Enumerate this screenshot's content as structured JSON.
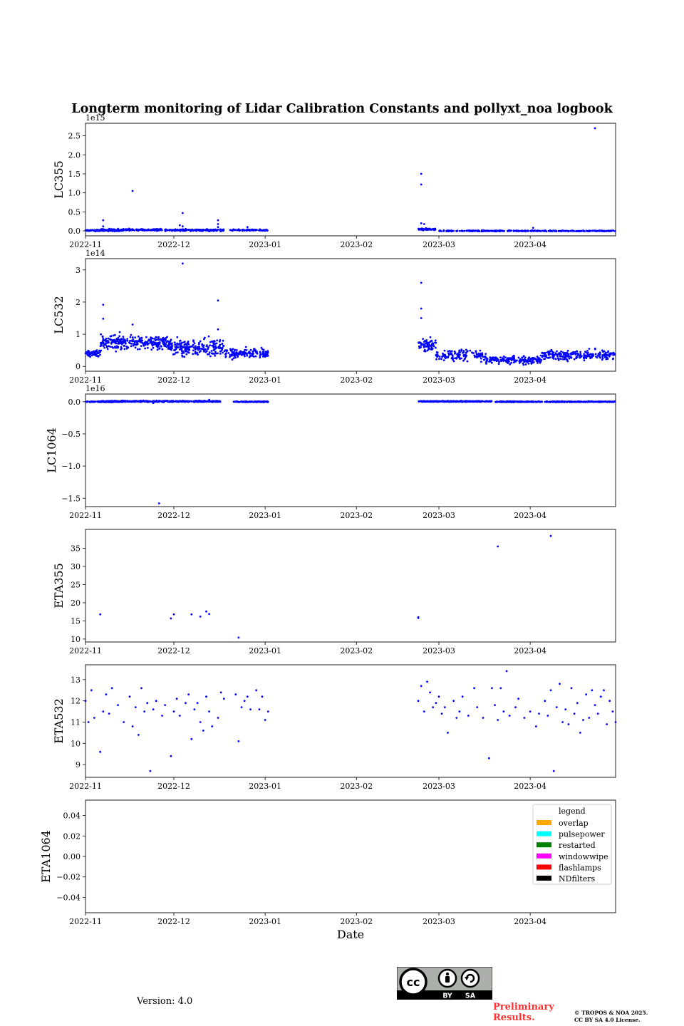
{
  "figure": {
    "title": "Longterm monitoring of Lidar Calibration Constants and pollyxt_noa logbook",
    "xlabel": "Date",
    "version_text": "Version: 4.0",
    "preliminary_line1": "Preliminary",
    "preliminary_line2": "Results.",
    "copyright_line1": "© TROPOS & NOA 2025.",
    "copyright_line2": "CC BY SA 4.0 License.",
    "license_badge": {
      "label_by": "BY",
      "label_sa": "SA",
      "icon": "cc-by-sa-icon"
    },
    "colors": {
      "points": "#0000ff",
      "text": "#000000",
      "prelim": "#ff3030"
    }
  },
  "chart_data": [
    {
      "type": "scatter",
      "ylabel": "LC355",
      "offset_text": "1e15",
      "x_ticks": [
        "2022-11",
        "2022-12",
        "2023-01",
        "2023-02",
        "2023-03",
        "2023-04"
      ],
      "x_range": [
        "2022-11-01",
        "2023-04-30"
      ],
      "y_ticks": [
        0.0,
        0.5,
        1.0,
        1.5,
        2.0,
        2.5
      ],
      "y_tick_labels": [
        "0.0",
        "0.5",
        "1.0",
        "1.5",
        "2.0",
        "2.5"
      ],
      "ylim": [
        -0.13,
        2.83
      ],
      "segments": [
        {
          "start": "2022-11-01",
          "end": "2022-11-14",
          "mean": 0.01,
          "spread": 0.015,
          "density": 8
        },
        {
          "start": "2022-11-06",
          "end": "2022-11-27",
          "mean": 0.03,
          "spread": 0.02,
          "density": 8
        },
        {
          "start": "2022-11-28",
          "end": "2022-12-18",
          "mean": 0.02,
          "spread": 0.02,
          "density": 8
        },
        {
          "start": "2022-12-20",
          "end": "2023-01-02",
          "mean": 0.02,
          "spread": 0.015,
          "density": 7
        },
        {
          "start": "2023-02-22",
          "end": "2023-02-28",
          "mean": 0.04,
          "spread": 0.02,
          "density": 9
        },
        {
          "start": "2023-03-01",
          "end": "2023-04-30",
          "mean": 0.0,
          "spread": 0.01,
          "density": 5
        }
      ],
      "outliers": [
        [
          "2022-11-07",
          0.28
        ],
        [
          "2022-11-07",
          0.12
        ],
        [
          "2022-11-17",
          1.05
        ],
        [
          "2022-12-04",
          0.47
        ],
        [
          "2022-12-03",
          0.15
        ],
        [
          "2022-12-04",
          0.12
        ],
        [
          "2022-12-16",
          0.28
        ],
        [
          "2022-12-16",
          0.18
        ],
        [
          "2022-12-16",
          0.1
        ],
        [
          "2022-12-26",
          0.1
        ],
        [
          "2023-02-23",
          1.5
        ],
        [
          "2023-02-23",
          1.22
        ],
        [
          "2023-02-23",
          0.2
        ],
        [
          "2023-02-24",
          0.18
        ],
        [
          "2023-04-02",
          0.08
        ],
        [
          "2023-04-23",
          2.7
        ]
      ]
    },
    {
      "type": "scatter",
      "ylabel": "LC532",
      "offset_text": "1e14",
      "x_ticks": [
        "2022-11",
        "2022-12",
        "2023-01",
        "2023-02",
        "2023-03",
        "2023-04"
      ],
      "x_range": [
        "2022-11-01",
        "2023-04-30"
      ],
      "y_ticks": [
        0,
        1,
        2,
        3
      ],
      "y_tick_labels": [
        "0",
        "1",
        "2",
        "3"
      ],
      "ylim": [
        -0.15,
        3.35
      ],
      "segments": [
        {
          "start": "2022-11-01",
          "end": "2022-11-06",
          "mean": 0.4,
          "spread": 0.1,
          "density": 10
        },
        {
          "start": "2022-11-06",
          "end": "2022-11-29",
          "mean": 0.75,
          "spread": 0.18,
          "density": 12
        },
        {
          "start": "2022-11-29",
          "end": "2022-12-18",
          "mean": 0.6,
          "spread": 0.2,
          "density": 12
        },
        {
          "start": "2022-12-18",
          "end": "2023-01-02",
          "mean": 0.4,
          "spread": 0.12,
          "density": 10
        },
        {
          "start": "2023-02-22",
          "end": "2023-02-28",
          "mean": 0.65,
          "spread": 0.15,
          "density": 12
        },
        {
          "start": "2023-02-28",
          "end": "2023-03-17",
          "mean": 0.35,
          "spread": 0.14,
          "density": 8
        },
        {
          "start": "2023-03-17",
          "end": "2023-04-05",
          "mean": 0.2,
          "spread": 0.1,
          "density": 9
        },
        {
          "start": "2023-04-05",
          "end": "2023-04-30",
          "mean": 0.35,
          "spread": 0.12,
          "density": 9
        }
      ],
      "outliers": [
        [
          "2022-11-07",
          1.92
        ],
        [
          "2022-11-07",
          1.48
        ],
        [
          "2022-11-17",
          1.3
        ],
        [
          "2022-12-04",
          3.2
        ],
        [
          "2022-12-16",
          2.05
        ],
        [
          "2022-12-16",
          1.15
        ],
        [
          "2023-02-23",
          2.6
        ],
        [
          "2023-02-23",
          1.8
        ],
        [
          "2023-02-23",
          1.5
        ]
      ]
    },
    {
      "type": "scatter",
      "ylabel": "LC1064",
      "offset_text": "1e16",
      "x_ticks": [
        "2022-11",
        "2022-12",
        "2023-01",
        "2023-02",
        "2023-03",
        "2023-04"
      ],
      "x_range": [
        "2022-11-01",
        "2023-04-30"
      ],
      "y_ticks": [
        0.0,
        -0.5,
        -1.0,
        -1.5
      ],
      "y_tick_labels": [
        "0.0",
        "−0.5",
        "−1.0",
        "−1.5"
      ],
      "ylim": [
        -1.63,
        0.12
      ],
      "segments": [
        {
          "start": "2022-11-01",
          "end": "2022-11-14",
          "mean": 0.0,
          "spread": 0.005,
          "density": 8
        },
        {
          "start": "2022-11-06",
          "end": "2022-12-17",
          "mean": 0.005,
          "spread": 0.008,
          "density": 10
        },
        {
          "start": "2022-12-21",
          "end": "2023-01-02",
          "mean": 0.0,
          "spread": 0.005,
          "density": 8
        },
        {
          "start": "2023-02-22",
          "end": "2023-03-19",
          "mean": 0.005,
          "spread": 0.006,
          "density": 10
        },
        {
          "start": "2023-03-20",
          "end": "2023-04-05",
          "mean": 0.0,
          "spread": 0.005,
          "density": 9
        },
        {
          "start": "2023-04-06",
          "end": "2023-04-30",
          "mean": 0.0,
          "spread": 0.005,
          "density": 9
        }
      ],
      "outliers": [
        [
          "2022-11-26",
          -1.58
        ],
        [
          "2022-12-13",
          0.03
        ],
        [
          "2022-11-24",
          -0.02
        ]
      ]
    },
    {
      "type": "scatter",
      "ylabel": "ETA355",
      "x_ticks": [
        "2022-11",
        "2022-12",
        "2023-01",
        "2023-02",
        "2023-03",
        "2023-04"
      ],
      "x_range": [
        "2022-11-01",
        "2023-04-30"
      ],
      "y_ticks": [
        10,
        15,
        20,
        25,
        30,
        35
      ],
      "y_tick_labels": [
        "10",
        "15",
        "20",
        "25",
        "30",
        "35"
      ],
      "ylim": [
        9.2,
        40.2
      ],
      "points": [
        [
          "2022-11-06",
          16.8
        ],
        [
          "2022-11-30",
          15.7
        ],
        [
          "2022-12-01",
          16.8
        ],
        [
          "2022-12-07",
          16.8
        ],
        [
          "2022-12-10",
          16.2
        ],
        [
          "2022-12-12",
          17.6
        ],
        [
          "2022-12-13",
          16.9
        ],
        [
          "2022-12-23",
          10.4
        ],
        [
          "2023-02-22",
          16.0
        ],
        [
          "2023-02-22",
          15.8
        ],
        [
          "2023-03-21",
          35.5
        ],
        [
          "2023-04-08",
          38.4
        ]
      ]
    },
    {
      "type": "scatter",
      "ylabel": "ETA532",
      "x_ticks": [
        "2022-11",
        "2022-12",
        "2023-01",
        "2023-02",
        "2023-03",
        "2023-04"
      ],
      "x_range": [
        "2022-11-01",
        "2023-04-30"
      ],
      "y_ticks": [
        9,
        10,
        11,
        12,
        13
      ],
      "y_tick_labels": [
        "9",
        "10",
        "11",
        "12",
        "13"
      ],
      "ylim": [
        8.4,
        13.7
      ],
      "points": [
        [
          "2022-11-01",
          12.0
        ],
        [
          "2022-11-02",
          11.0
        ],
        [
          "2022-11-03",
          12.5
        ],
        [
          "2022-11-04",
          11.2
        ],
        [
          "2022-11-06",
          9.6
        ],
        [
          "2022-11-07",
          11.5
        ],
        [
          "2022-11-08",
          12.3
        ],
        [
          "2022-11-09",
          11.4
        ],
        [
          "2022-11-10",
          12.6
        ],
        [
          "2022-11-12",
          11.8
        ],
        [
          "2022-11-14",
          11.0
        ],
        [
          "2022-11-16",
          12.2
        ],
        [
          "2022-11-17",
          10.8
        ],
        [
          "2022-11-18",
          11.7
        ],
        [
          "2022-11-19",
          10.4
        ],
        [
          "2022-11-20",
          12.6
        ],
        [
          "2022-11-21",
          11.5
        ],
        [
          "2022-11-22",
          11.9
        ],
        [
          "2022-11-23",
          8.7
        ],
        [
          "2022-11-24",
          11.6
        ],
        [
          "2022-11-25",
          12.0
        ],
        [
          "2022-11-27",
          11.3
        ],
        [
          "2022-11-28",
          11.8
        ],
        [
          "2022-11-30",
          9.4
        ],
        [
          "2022-12-01",
          11.5
        ],
        [
          "2022-12-02",
          12.1
        ],
        [
          "2022-12-03",
          11.3
        ],
        [
          "2022-12-05",
          11.9
        ],
        [
          "2022-12-06",
          12.3
        ],
        [
          "2022-12-07",
          10.2
        ],
        [
          "2022-12-08",
          11.6
        ],
        [
          "2022-12-09",
          11.9
        ],
        [
          "2022-12-10",
          11.0
        ],
        [
          "2022-12-11",
          10.6
        ],
        [
          "2022-12-12",
          12.2
        ],
        [
          "2022-12-13",
          11.5
        ],
        [
          "2022-12-14",
          10.8
        ],
        [
          "2022-12-16",
          11.2
        ],
        [
          "2022-12-17",
          12.4
        ],
        [
          "2022-12-18",
          12.1
        ],
        [
          "2022-12-22",
          12.3
        ],
        [
          "2022-12-23",
          10.1
        ],
        [
          "2022-12-24",
          11.7
        ],
        [
          "2022-12-25",
          12.0
        ],
        [
          "2022-12-26",
          12.2
        ],
        [
          "2022-12-27",
          11.6
        ],
        [
          "2022-12-29",
          12.5
        ],
        [
          "2022-12-30",
          11.6
        ],
        [
          "2022-12-31",
          12.2
        ],
        [
          "2023-01-01",
          11.1
        ],
        [
          "2023-01-02",
          11.5
        ],
        [
          "2023-02-22",
          12.0
        ],
        [
          "2023-02-23",
          12.7
        ],
        [
          "2023-02-24",
          11.5
        ],
        [
          "2023-02-25",
          12.9
        ],
        [
          "2023-02-26",
          12.4
        ],
        [
          "2023-02-27",
          11.7
        ],
        [
          "2023-02-28",
          11.9
        ],
        [
          "2023-03-01",
          12.2
        ],
        [
          "2023-03-02",
          11.4
        ],
        [
          "2023-03-03",
          11.7
        ],
        [
          "2023-03-04",
          10.5
        ],
        [
          "2023-03-06",
          12.0
        ],
        [
          "2023-03-07",
          11.2
        ],
        [
          "2023-03-08",
          11.5
        ],
        [
          "2023-03-09",
          12.2
        ],
        [
          "2023-03-11",
          11.3
        ],
        [
          "2023-03-13",
          12.6
        ],
        [
          "2023-03-14",
          11.7
        ],
        [
          "2023-03-16",
          11.2
        ],
        [
          "2023-03-18",
          9.3
        ],
        [
          "2023-03-19",
          12.6
        ],
        [
          "2023-03-20",
          11.8
        ],
        [
          "2023-03-21",
          11.1
        ],
        [
          "2023-03-22",
          12.6
        ],
        [
          "2023-03-23",
          11.5
        ],
        [
          "2023-03-24",
          13.4
        ],
        [
          "2023-03-25",
          11.3
        ],
        [
          "2023-03-27",
          11.7
        ],
        [
          "2023-03-28",
          12.1
        ],
        [
          "2023-03-30",
          11.2
        ],
        [
          "2023-04-01",
          11.5
        ],
        [
          "2023-04-03",
          10.8
        ],
        [
          "2023-04-04",
          11.4
        ],
        [
          "2023-04-06",
          12.0
        ],
        [
          "2023-04-07",
          11.3
        ],
        [
          "2023-04-08",
          12.5
        ],
        [
          "2023-04-09",
          8.7
        ],
        [
          "2023-04-10",
          11.7
        ],
        [
          "2023-04-11",
          12.8
        ],
        [
          "2023-04-12",
          11.0
        ],
        [
          "2023-04-13",
          11.6
        ],
        [
          "2023-04-14",
          10.9
        ],
        [
          "2023-04-15",
          12.6
        ],
        [
          "2023-04-16",
          11.4
        ],
        [
          "2023-04-17",
          11.9
        ],
        [
          "2023-04-18",
          10.5
        ],
        [
          "2023-04-19",
          11.1
        ],
        [
          "2023-04-20",
          12.3
        ],
        [
          "2023-04-21",
          11.2
        ],
        [
          "2023-04-22",
          12.5
        ],
        [
          "2023-04-23",
          11.8
        ],
        [
          "2023-04-24",
          11.4
        ],
        [
          "2023-04-25",
          12.2
        ],
        [
          "2023-04-26",
          12.5
        ],
        [
          "2023-04-27",
          10.9
        ],
        [
          "2023-04-28",
          12.0
        ],
        [
          "2023-04-29",
          11.5
        ],
        [
          "2023-04-30",
          11.0
        ]
      ]
    },
    {
      "type": "scatter",
      "ylabel": "ETA1064",
      "x_ticks": [
        "2022-11",
        "2022-12",
        "2023-01",
        "2023-02",
        "2023-03",
        "2023-04"
      ],
      "x_range": [
        "2022-11-01",
        "2023-04-30"
      ],
      "y_ticks": [
        0.04,
        0.02,
        0.0,
        -0.02,
        -0.04
      ],
      "y_tick_labels": [
        "0.04",
        "0.02",
        "0.00",
        "−0.02",
        "−0.04"
      ],
      "ylim": [
        -0.055,
        0.055
      ],
      "points": [],
      "legend": {
        "title": "legend",
        "placement": "top-right",
        "entries": [
          {
            "label": "overlap",
            "color": "#ffa500"
          },
          {
            "label": "pulsepower",
            "color": "#00ffff"
          },
          {
            "label": "restarted",
            "color": "#008000"
          },
          {
            "label": "windowwipe",
            "color": "#ff00ff"
          },
          {
            "label": "flashlamps",
            "color": "#ff0000"
          },
          {
            "label": "NDfilters",
            "color": "#000000"
          }
        ]
      }
    }
  ]
}
